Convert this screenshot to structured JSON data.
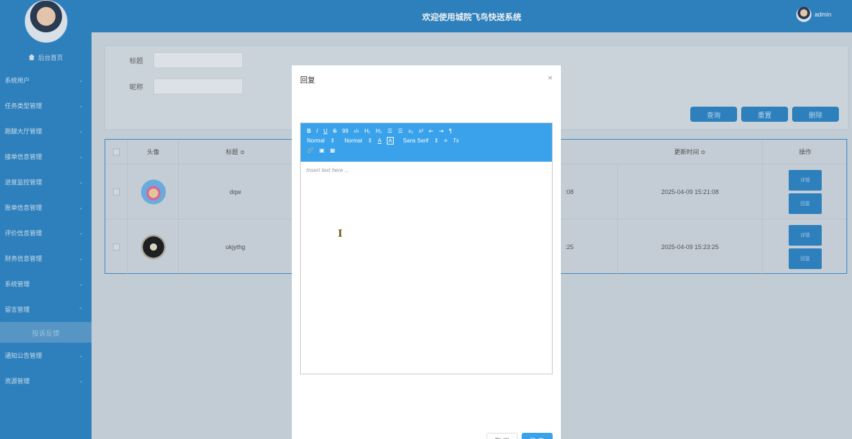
{
  "header": {
    "title": "欢迎使用城院飞鸟快送系统",
    "username": "admin"
  },
  "sidebar": {
    "home_label": "后台首页",
    "items": [
      {
        "label": "系统用户"
      },
      {
        "label": "任务类型管理"
      },
      {
        "label": "跑腿大厅管理"
      },
      {
        "label": "接单信息管理"
      },
      {
        "label": "进度监控管理"
      },
      {
        "label": "账单信息管理"
      },
      {
        "label": "评价信息管理"
      },
      {
        "label": "财务信息管理"
      },
      {
        "label": "系统管理"
      },
      {
        "label": "留言管理",
        "expanded": true
      },
      {
        "label": "通知公告管理"
      },
      {
        "label": "资源管理"
      }
    ],
    "sub_item": "投诉反馈"
  },
  "search": {
    "title_label": "标题",
    "nickname_label": "昵称",
    "query_button": "查询",
    "reset_button": "重置",
    "delete_button": "删除"
  },
  "table": {
    "headers": [
      "头像",
      "标题 ≎",
      "更新时间 ≎",
      "操作"
    ],
    "rows": [
      {
        "title": "dqw",
        "created_tail": ":08",
        "updated": "2025-04-09 15:21:08",
        "detail": "详情",
        "reply": "回复"
      },
      {
        "title": "ukjythg",
        "created_tail": ":25",
        "updated": "2025-04-09 15:23:25",
        "detail": "详情",
        "reply": "回复"
      }
    ]
  },
  "dialog": {
    "title": "回复",
    "close": "×",
    "toolbar": {
      "line1": [
        "B",
        "I",
        "U",
        "S",
        "99",
        "‹/›",
        "H₁",
        "H₂",
        "☰",
        "☰",
        "x₂",
        "x²",
        "⇤",
        "⇥",
        "¶"
      ],
      "line2": [
        "Normal",
        "⇕",
        "Normal",
        "⇕",
        "A",
        "A",
        "Sans Serif",
        "⇕",
        "≡",
        "Tx"
      ],
      "line3": [
        "🔗",
        "▣",
        "▦"
      ]
    },
    "placeholder": "Insert text here ...",
    "cancel": "取 消",
    "confirm": "确 定"
  },
  "colors": {
    "primary": "#2f86c7",
    "toolbar": "#3aa2ea"
  }
}
